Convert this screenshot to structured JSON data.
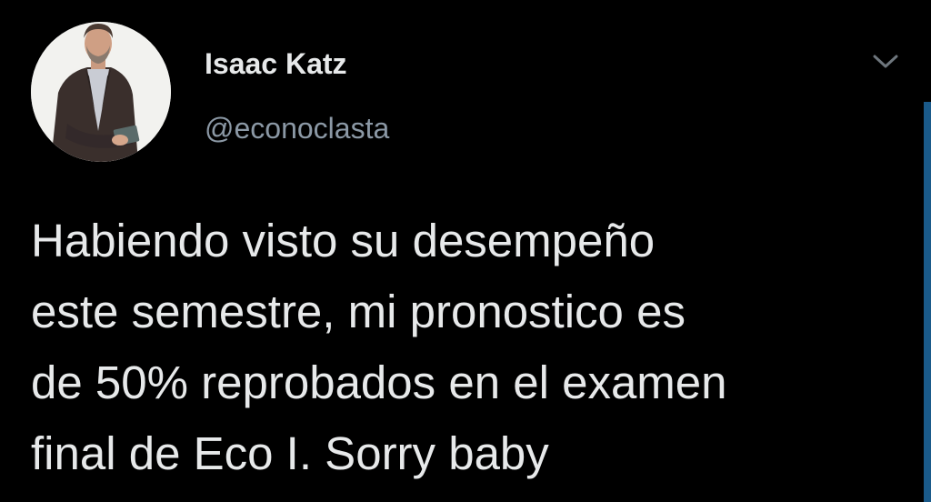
{
  "tweet": {
    "author": {
      "display_name": "Isaac Katz",
      "handle": "@econoclasta",
      "avatar": "profile-photo"
    },
    "menu_icon": "chevron-down-icon",
    "text": "Habiendo visto su desempeño\neste semestre, mi pronostico es\nde 50% reprobados en el examen\nfinal de Eco I. Sorry baby"
  },
  "colors": {
    "background": "#000000",
    "text_primary": "#e7e9ea",
    "text_secondary": "#8b98a5"
  }
}
